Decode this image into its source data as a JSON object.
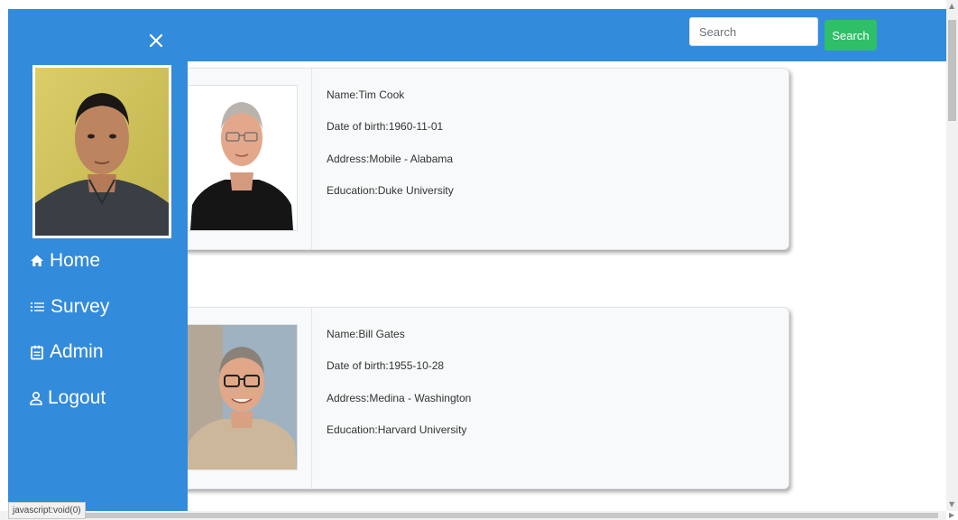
{
  "header": {
    "search_placeholder": "Search",
    "search_button": "Search"
  },
  "sidebar": {
    "items": [
      {
        "label": "Home",
        "icon": "home-icon"
      },
      {
        "label": "Survey",
        "icon": "list-icon"
      },
      {
        "label": "Admin",
        "icon": "clipboard-icon"
      },
      {
        "label": "Logout",
        "icon": "user-icon"
      }
    ]
  },
  "cards": [
    {
      "name": "Name:Tim Cook",
      "dob": "Date of birth:1960-11-01",
      "address": "Address:Mobile - Alabama",
      "education": "Education:Duke University"
    },
    {
      "name": "Name:Bill Gates",
      "dob": "Date of birth:1955-10-28",
      "address": "Address:Medina - Washington",
      "education": "Education:Harvard University"
    }
  ],
  "status_bar": "javascript:void(0)",
  "colors": {
    "primary": "#338bdb",
    "search_button": "#2fbf68",
    "card_bg": "#f8f9fa"
  }
}
